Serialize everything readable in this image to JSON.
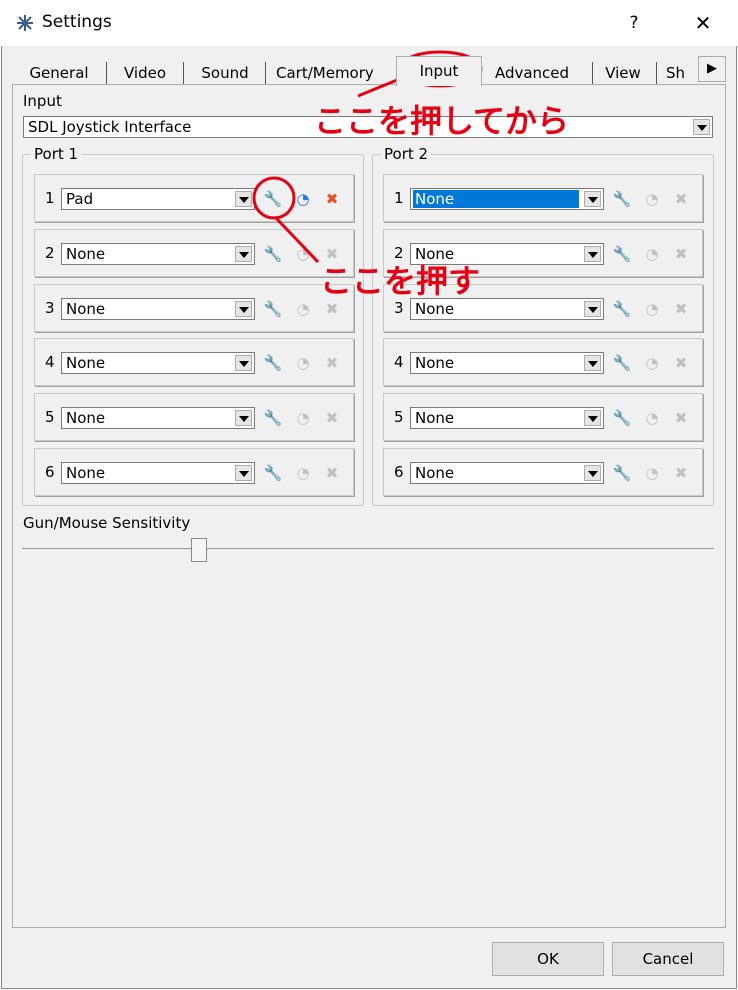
{
  "window": {
    "title": "Settings",
    "help_label": "?",
    "close_label": "✕"
  },
  "tabs": [
    {
      "label": "General"
    },
    {
      "label": "Video"
    },
    {
      "label": "Sound"
    },
    {
      "label": "Cart/Memory"
    },
    {
      "label": "Input",
      "active": true
    },
    {
      "label": "Advanced"
    },
    {
      "label": "View"
    },
    {
      "label": "Sh"
    }
  ],
  "input": {
    "label": "Input",
    "device": "SDL Joystick Interface"
  },
  "port1": {
    "title": "Port 1",
    "slots": [
      {
        "num": "1",
        "value": "Pad",
        "enabled": true
      },
      {
        "num": "2",
        "value": "None",
        "enabled": false
      },
      {
        "num": "3",
        "value": "None",
        "enabled": false
      },
      {
        "num": "4",
        "value": "None",
        "enabled": false
      },
      {
        "num": "5",
        "value": "None",
        "enabled": false
      },
      {
        "num": "6",
        "value": "None",
        "enabled": false
      }
    ]
  },
  "port2": {
    "title": "Port 2",
    "slots": [
      {
        "num": "1",
        "value": "None",
        "selected": true
      },
      {
        "num": "2",
        "value": "None"
      },
      {
        "num": "3",
        "value": "None"
      },
      {
        "num": "4",
        "value": "None"
      },
      {
        "num": "5",
        "value": "None"
      },
      {
        "num": "6",
        "value": "None"
      }
    ]
  },
  "sensitivity": {
    "label": "Gun/Mouse Sensitivity",
    "value_fraction": 0.25
  },
  "buttons": {
    "ok": "OK",
    "cancel": "Cancel"
  },
  "annotations": {
    "tab_note": "ここを押してから",
    "button_note": "ここを押す",
    "color": "#e60012"
  },
  "colors": {
    "selection": "#0078d7",
    "gauge_active": "#2f7bd9",
    "clear_active": "#e8501e",
    "wrench_active": "#d9a02a"
  }
}
